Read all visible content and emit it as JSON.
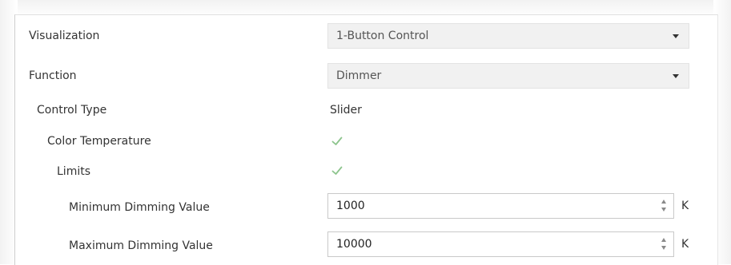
{
  "rows": {
    "visualization": {
      "label": "Visualization",
      "value": "1-Button Control"
    },
    "function": {
      "label": "Function",
      "value": "Dimmer"
    },
    "control_type": {
      "label": "Control Type",
      "value": "Slider"
    },
    "color_temperature": {
      "label": "Color Temperature",
      "checked": true
    },
    "limits": {
      "label": "Limits",
      "checked": true
    },
    "minimum_dimming": {
      "label": "Minimum Dimming Value",
      "value": "1000",
      "unit": "K"
    },
    "maximum_dimming": {
      "label": "Maximum Dimming Value",
      "value": "10000",
      "unit": "K"
    }
  },
  "icons": {
    "dropdown": "chevron-down-icon",
    "check": "checkmark-icon",
    "spinner": "spinner-arrows-icon"
  },
  "colors": {
    "check": "#8cc48c",
    "select_bg": "#f1f1f1"
  }
}
